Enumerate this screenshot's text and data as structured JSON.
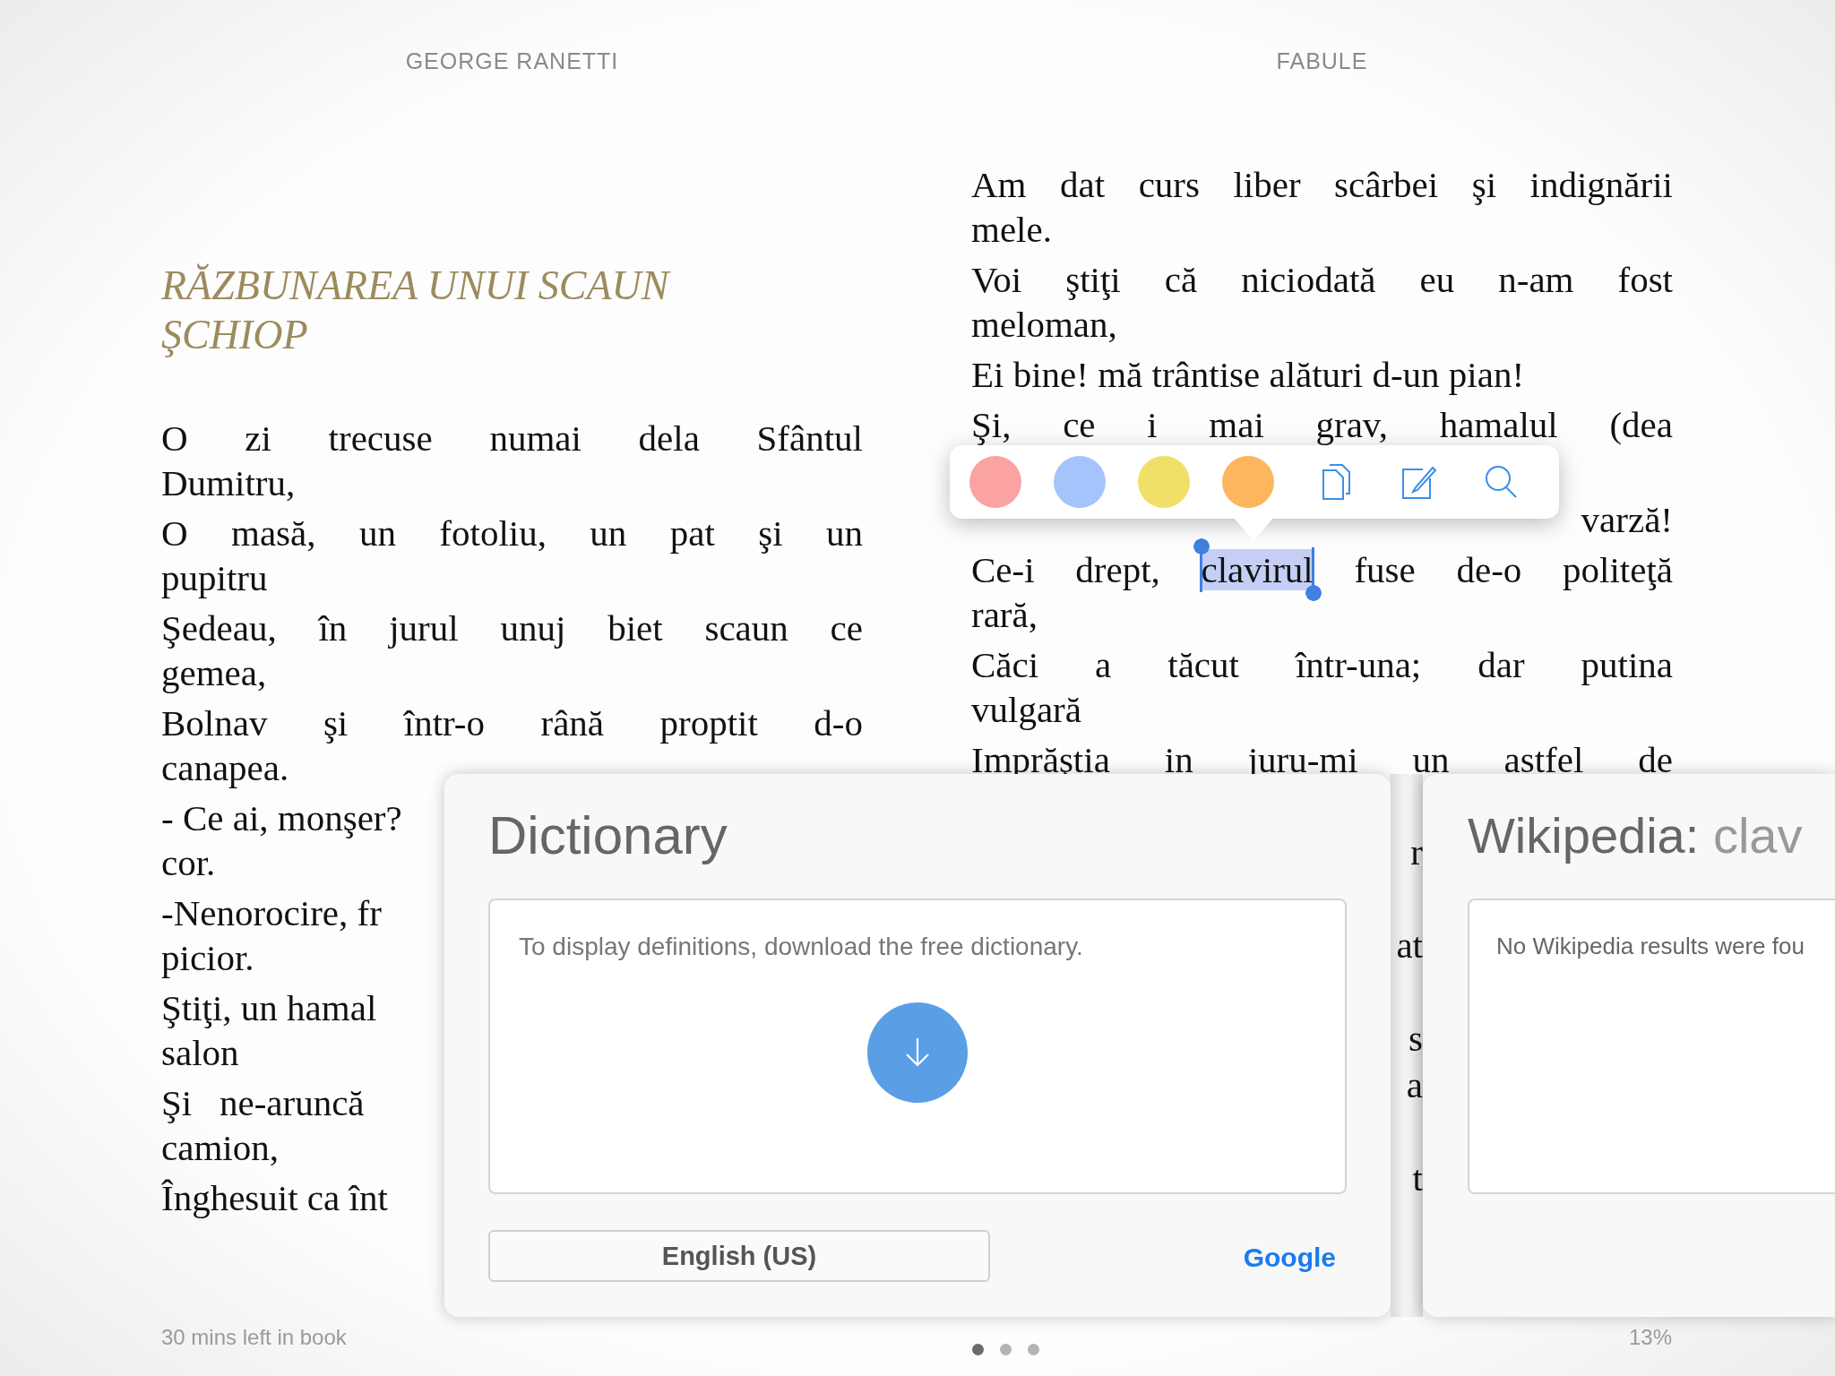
{
  "header": {
    "author": "GEORGE RANETTI",
    "book": "FABULE"
  },
  "left_page": {
    "title": "RĂZBUNAREA UNUI SCAUN ŞCHIOP",
    "verses": [
      {
        "cut_by_panel": false,
        "lines": [
          {
            "text": "O zi trecuse numai dela Sfântul"
          },
          {
            "text": "Dumitru,"
          }
        ]
      },
      {
        "cut_by_panel": false,
        "lines": [
          {
            "text": "O masă, un fotoliu, un pat şi un"
          },
          {
            "text": "pupitru"
          }
        ]
      },
      {
        "cut_by_panel": false,
        "lines": [
          {
            "text": "Şedeau, în jurul unuj biet scaun ce"
          },
          {
            "text": "gemea,"
          }
        ]
      },
      {
        "cut_by_panel": false,
        "lines": [
          {
            "text": "Bolnav şi într-o rână proptit d-o"
          },
          {
            "text": "canapea."
          }
        ]
      },
      {
        "cut_by_panel": true,
        "lines": [
          {
            "text": "- Ce ai, monşer?"
          },
          {
            "text": "cor."
          }
        ]
      },
      {
        "cut_by_panel": true,
        "lines": [
          {
            "text": "-Nenorocire, fr"
          },
          {
            "text": "picior."
          }
        ]
      },
      {
        "cut_by_panel": true,
        "lines": [
          {
            "text": "Ştiţi, un hamal"
          },
          {
            "text": "salon"
          }
        ]
      },
      {
        "cut_by_panel": true,
        "lines": [
          {
            "text": "Şi   ne-aruncă"
          },
          {
            "text": "camion,"
          }
        ]
      },
      {
        "lines": [
          {
            "text": "Înghesuit ca înt"
          }
        ]
      }
    ]
  },
  "right_page": {
    "verses": [
      {
        "lines": [
          {
            "text": "Am dat curs liber scârbei şi indignării"
          },
          {
            "text": "mele."
          }
        ]
      },
      {
        "lines": [
          {
            "text": "Voi ştiţi că niciodată eu n-am fost"
          },
          {
            "text": "meloman,"
          }
        ]
      },
      {
        "lines": [
          {
            "text": "Ei bine! mă trântise alături d-un pian!"
          }
        ]
      },
      {
        "continues_hidden": true,
        "lines": [
          {
            "text": "Şi, ce i mai grav, hamalul (dea"
          }
        ]
      },
      {
        "lines": [
          {
            "text": "varză!",
            "covered_start": true
          }
        ]
      },
      {
        "lines": [
          {
            "segments": [
              {
                "text": "Ce-i drept, ",
                "selected": false
              },
              {
                "text": "clavirul",
                "selected": true
              },
              {
                "text": " fuse de-o politeţă",
                "selected": false
              }
            ]
          },
          {
            "text": "rară,"
          }
        ]
      },
      {
        "lines": [
          {
            "text": "Căci a tăcut într-una; dar putina"
          },
          {
            "text": "vulgară"
          }
        ]
      },
      {
        "continues_hidden": true,
        "lines": [
          {
            "text": "Imprăştia in juru-mi un astfel de"
          }
        ]
      }
    ],
    "gap_fragments": [
      [
        "r"
      ],
      [
        "at"
      ],
      [
        "s",
        "a"
      ],
      [
        "t"
      ]
    ]
  },
  "selection_menu": {
    "highlight_colors": [
      {
        "color": "#fba3a3"
      },
      {
        "color": "#a4c4fb"
      },
      {
        "color": "#f0e068"
      },
      {
        "color": "#fdb65e"
      }
    ],
    "actions": [
      {
        "kind": "copy"
      },
      {
        "kind": "note"
      },
      {
        "kind": "search"
      }
    ]
  },
  "dictionary": {
    "title": "Dictionary",
    "message": "To display definitions, download the free dictionary.",
    "language": "English (US)",
    "link": "Google"
  },
  "wikipedia": {
    "title": "Wikipedia:",
    "term": "clav",
    "message": "No Wikipedia results were fou"
  },
  "page_dots": [
    {
      "selected": true
    },
    {
      "selected": false
    },
    {
      "selected": false
    }
  ],
  "footer": {
    "time_left": "30 mins left in book",
    "progress": "13%"
  }
}
